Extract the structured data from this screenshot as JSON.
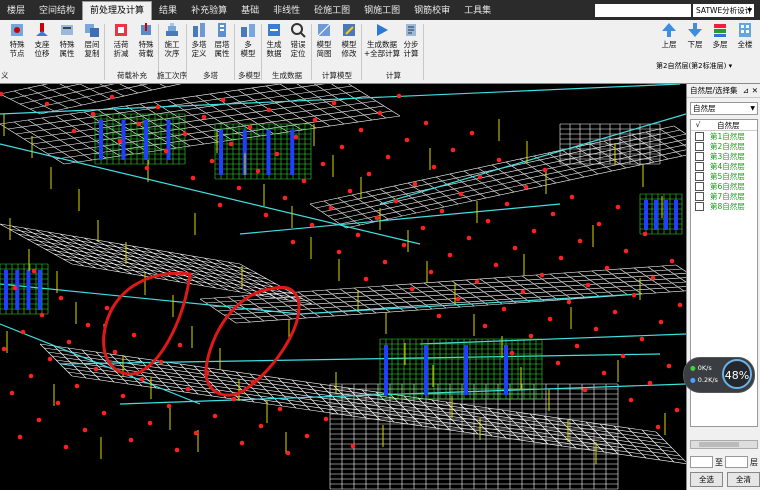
{
  "menu": {
    "tabs": [
      "楼层",
      "空间结构",
      "前处理及计算",
      "结果",
      "补充验算",
      "基础",
      "非线性",
      "砼施工图",
      "钢施工图",
      "钢筋校审",
      "工具集"
    ],
    "active_index": 2,
    "mode_select": "SATWE分析设计"
  },
  "ribbon": {
    "buttons": [
      {
        "label1": "特殊",
        "label2": "节点",
        "icon": "special-node-icon"
      },
      {
        "label1": "支座",
        "label2": "位移",
        "icon": "support-displacement-icon"
      },
      {
        "label1": "特殊",
        "label2": "属性",
        "icon": "special-attribute-icon"
      },
      {
        "label1": "层间",
        "label2": "复制",
        "icon": "floor-copy-icon"
      },
      {
        "label1": "活荷",
        "label2": "折减",
        "icon": "live-load-reduce-icon"
      },
      {
        "label1": "特殊",
        "label2": "荷载",
        "icon": "special-load-icon"
      },
      {
        "label1": "施工",
        "label2": "次序",
        "icon": "construction-order-icon"
      },
      {
        "label1": "多塔",
        "label2": "定义",
        "icon": "tower-define-icon"
      },
      {
        "label1": "层塔",
        "label2": "属性",
        "icon": "tower-attribute-icon"
      },
      {
        "label1": "多",
        "label2": "模型",
        "icon": "multi-model-icon"
      },
      {
        "label1": "生成",
        "label2": "数据",
        "icon": "generate-data-icon"
      },
      {
        "label1": "错误",
        "label2": "定位",
        "icon": "error-locate-icon"
      },
      {
        "label1": "模型",
        "label2": "简图",
        "icon": "model-sketch-icon"
      },
      {
        "label1": "模型",
        "label2": "修改",
        "icon": "model-modify-icon"
      },
      {
        "label1": "生成数据",
        "label2": "+全部计算",
        "icon": "run-all-icon"
      },
      {
        "label1": "分步",
        "label2": "计算",
        "icon": "step-calc-icon"
      }
    ],
    "groups": [
      "义",
      "荷载补充",
      "施工次序",
      "多塔",
      "多模型",
      "生成数据",
      "计算模型",
      "计算"
    ],
    "right_tools": [
      {
        "label": "上层",
        "icon": "up-floor-icon"
      },
      {
        "label": "下层",
        "icon": "down-floor-icon"
      },
      {
        "label": "多层",
        "icon": "multi-floor-icon"
      },
      {
        "label": "全楼",
        "icon": "whole-building-icon"
      }
    ],
    "floor_indicator": "第2自然层(第2标准层)"
  },
  "side_panel": {
    "title": "自然层/选择集",
    "select_value": "自然层",
    "column_check": "√",
    "column_name": "自然层",
    "floors": [
      "第1自然层",
      "第2自然层",
      "第3自然层",
      "第4自然层",
      "第5自然层",
      "第6自然层",
      "第7自然层",
      "第8自然层"
    ],
    "range_separator": "至",
    "range_suffix": "层",
    "button_all": "全选",
    "button_clear": "全清"
  },
  "gauge": {
    "percent": "48%",
    "upload": "0K/s",
    "download": "0.2K/s"
  },
  "colors": {
    "menubar": "#2b2b2b",
    "ribbon": "#f0f0f0",
    "canvas": "#000000",
    "grid_cyan": "#40e0e0",
    "grid_white": "#ffffff",
    "wall_green": "#30e030",
    "wall_blue": "#2040ff",
    "column_yellow": "#d8d800",
    "node_red": "#ff2020",
    "annotation_red": "#e01818",
    "floor_green": "#1a9a1a"
  }
}
